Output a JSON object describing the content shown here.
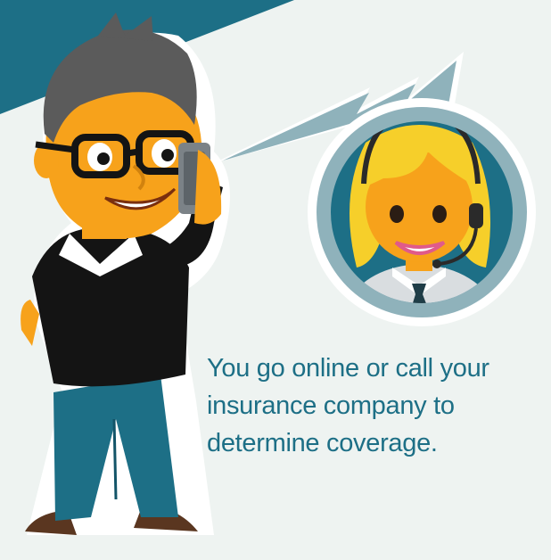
{
  "caption": {
    "text": "You go online or call your insurance company to determine coverage."
  },
  "colors": {
    "background": "#eef3f1",
    "corner_band": "#1d6f86",
    "caption_text": "#1d6f86",
    "skin": "#f7a21b",
    "sweater": "#141414",
    "jeans": "#1d6f86",
    "agent_hair": "#f6cf2a",
    "bubble_ring": "#8fb2bb",
    "bubble_fill": "#1d6f86"
  },
  "illustration": {
    "man_on_phone": "man-on-phone-figure",
    "agent": "call-center-agent-figure",
    "signal": "phone-signal-bolt"
  }
}
